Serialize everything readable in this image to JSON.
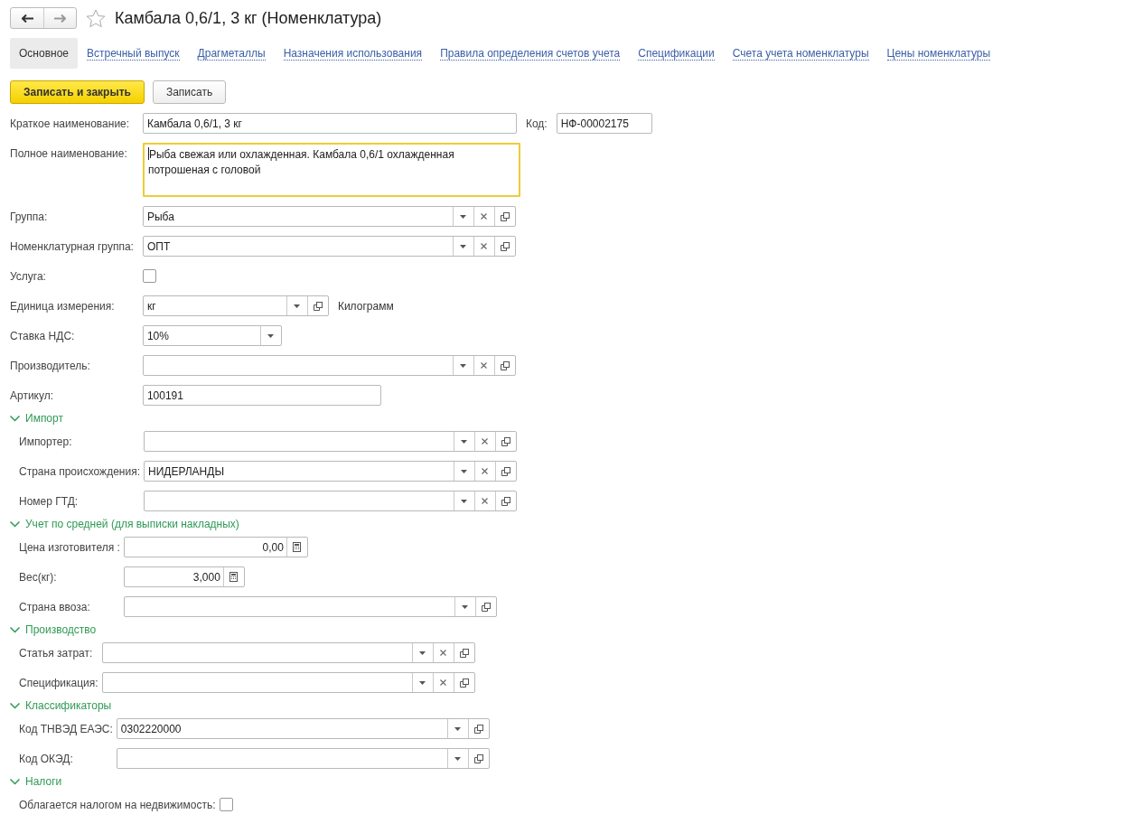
{
  "window": {
    "title": "Камбала 0,6/1, 3 кг (Номенклатура)",
    "favorite": false
  },
  "tabs": [
    {
      "label": "Основное",
      "selected": true
    },
    {
      "label": "Встречный выпуск",
      "selected": false
    },
    {
      "label": "Драгметаллы",
      "selected": false
    },
    {
      "label": "Назначения использования",
      "selected": false
    },
    {
      "label": "Правила определения счетов учета",
      "selected": false
    },
    {
      "label": "Спецификации",
      "selected": false
    },
    {
      "label": "Счета учета номенклатуры",
      "selected": false
    },
    {
      "label": "Цены номенклатуры",
      "selected": false
    }
  ],
  "buttons": [
    {
      "label": "Записать и закрыть",
      "kind": "primary"
    },
    {
      "label": "Записать",
      "kind": "default"
    }
  ],
  "main_fields": [
    {
      "kind": "name-code",
      "label": "Краткое наименование:",
      "value": "Камбала 0,6/1, 3 кг",
      "code_label": "Код:",
      "code_value": "НФ-00002175"
    },
    {
      "kind": "textarea",
      "label": "Полное наименование:",
      "value": "Рыба свежая или охлажденная. Камбала 0,6/1 охлажденная потрошеная с головой",
      "focused": true
    },
    {
      "kind": "ref",
      "label": "Группа:",
      "value": "Рыба",
      "clearable": true
    },
    {
      "kind": "ref",
      "label": "Номенклатурная группа:",
      "value": "ОПТ",
      "clearable": true
    },
    {
      "kind": "checkbox",
      "label": "Услуга:",
      "checked": false
    },
    {
      "kind": "unit",
      "label": "Единица измерения:",
      "value": "кг",
      "note": "Килограмм"
    },
    {
      "kind": "combo",
      "label": "Ставка НДС:",
      "value": "10%"
    },
    {
      "kind": "ref",
      "label": "Производитель:",
      "clearable": true
    },
    {
      "kind": "text",
      "label": "Артикул:",
      "value": "100191"
    }
  ],
  "sections": [
    {
      "title": "Импорт",
      "expanded": true,
      "fields": [
        {
          "kind": "ref",
          "label": "Импортер:",
          "clearable": true
        },
        {
          "kind": "ref",
          "label": "Страна происхождения:",
          "value": "НИДЕРЛАНДЫ",
          "clearable": true
        },
        {
          "kind": "ref",
          "label": "Номер ГТД:",
          "clearable": true
        }
      ]
    },
    {
      "title": "Учет по средней (для выписки накладных)",
      "expanded": true,
      "fields": [
        {
          "kind": "number",
          "label": "Цена изготовителя :",
          "value": "0,00"
        },
        {
          "kind": "number",
          "label": "Вес(кг):",
          "value": "3,000"
        },
        {
          "kind": "ref",
          "label": "Страна ввоза:",
          "clearable": false
        }
      ]
    },
    {
      "title": "Производство",
      "expanded": true,
      "fields": [
        {
          "kind": "ref",
          "label": "Статья затрат:",
          "clearable": true
        },
        {
          "kind": "ref",
          "label": "Спецификация:",
          "clearable": true
        }
      ]
    },
    {
      "title": "Классификаторы",
      "expanded": true,
      "fields": [
        {
          "kind": "ref",
          "label": "Код ТНВЭД ЕАЭС:",
          "value": "0302220000",
          "clearable": false
        },
        {
          "kind": "ref",
          "label": "Код ОКЭД:",
          "clearable": false
        }
      ]
    },
    {
      "title": "Налоги",
      "expanded": true,
      "fields": [
        {
          "kind": "checkbox",
          "label": "Облагается налогом на недвижимость:",
          "checked": false
        }
      ]
    }
  ]
}
